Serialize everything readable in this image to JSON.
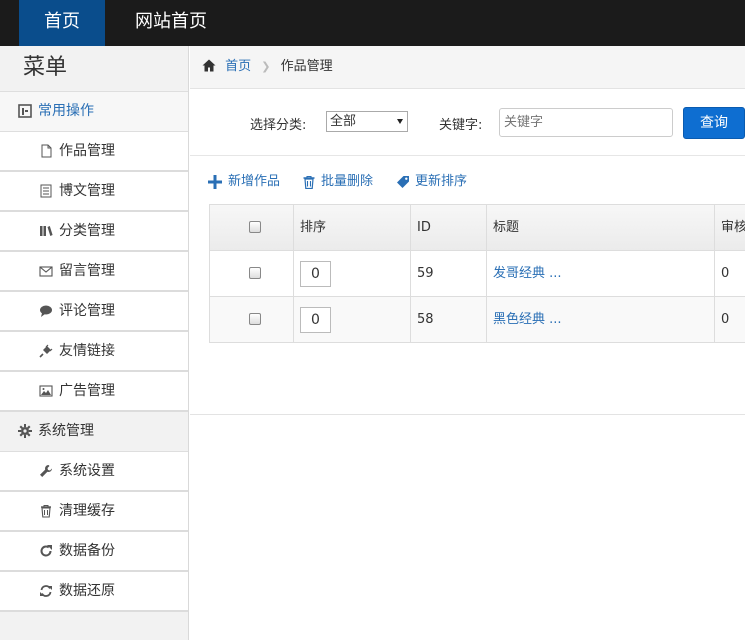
{
  "topnav": {
    "home": "首页",
    "site_home": "网站首页"
  },
  "sidebar": {
    "title": "菜单",
    "groups": [
      {
        "label": "常用操作",
        "items": [
          {
            "label": "作品管理",
            "icon": "file-icon"
          },
          {
            "label": "博文管理",
            "icon": "doc-list-icon"
          },
          {
            "label": "分类管理",
            "icon": "books-icon"
          },
          {
            "label": "留言管理",
            "icon": "envelope-icon"
          },
          {
            "label": "评论管理",
            "icon": "comment-icon"
          },
          {
            "label": "友情链接",
            "icon": "plug-icon"
          },
          {
            "label": "广告管理",
            "icon": "picture-icon"
          }
        ]
      },
      {
        "label": "系统管理",
        "items": [
          {
            "label": "系统设置",
            "icon": "wrench-icon"
          },
          {
            "label": "清理缓存",
            "icon": "trash-icon"
          },
          {
            "label": "数据备份",
            "icon": "refresh-icon"
          },
          {
            "label": "数据还原",
            "icon": "sync-icon"
          }
        ]
      }
    ]
  },
  "breadcrumb": {
    "home": "首页",
    "current": "作品管理"
  },
  "search": {
    "category_label": "选择分类:",
    "category_value": "全部",
    "keyword_label": "关键字:",
    "keyword_placeholder": "关键字",
    "query_button": "查询"
  },
  "toolbar": {
    "add": "新增作品",
    "batch_delete": "批量删除",
    "update_sort": "更新排序"
  },
  "table": {
    "columns": [
      "排序",
      "ID",
      "标题",
      "审核"
    ],
    "rows": [
      {
        "sort": "0",
        "id": "59",
        "title": "发哥经典 ...",
        "audit": "0"
      },
      {
        "sort": "0",
        "id": "58",
        "title": "黑色经典 ...",
        "audit": "0"
      }
    ]
  },
  "colors": {
    "accent": "#2a6fb5",
    "topbar": "#1b1b1b",
    "nav_active": "#0a4d8c",
    "button": "#0e6ed1"
  }
}
